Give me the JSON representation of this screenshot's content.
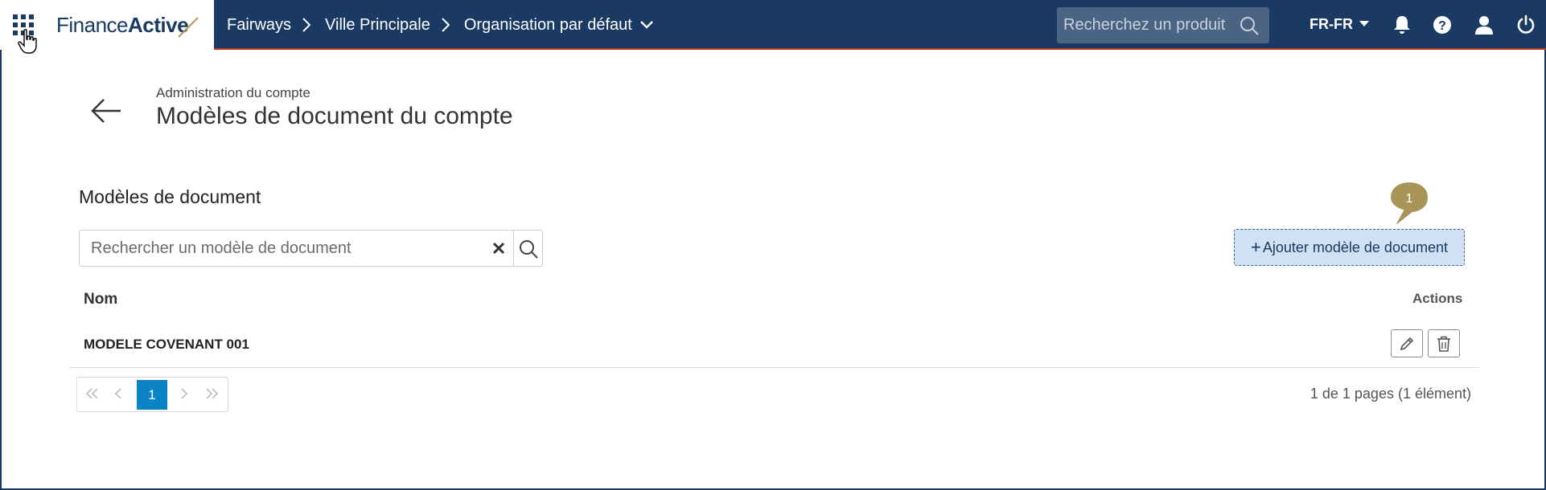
{
  "header": {
    "brand": {
      "part1": "Finance",
      "part2": "Active"
    },
    "breadcrumbs": [
      {
        "label": "Fairways"
      },
      {
        "label": "Ville Principale"
      },
      {
        "label": "Organisation par défaut"
      }
    ],
    "search_placeholder": "Recherchez un produit",
    "language": "FR-FR",
    "icons": [
      "apps-grid-icon",
      "bell-icon",
      "help-icon",
      "user-icon",
      "power-icon"
    ],
    "colors": {
      "bar": "#1b3a63",
      "accent_line": "#c0392b"
    }
  },
  "page": {
    "subtitle": "Administration du compte",
    "title": "Modèles de document du compte"
  },
  "section": {
    "title": "Modèles de document",
    "search_placeholder": "Rechercher un modèle de document",
    "add_button_label": "Ajouter modèle de document",
    "callout_number": "1"
  },
  "table": {
    "columns": {
      "name": "Nom",
      "actions": "Actions"
    },
    "rows": [
      {
        "name": "MODELE COVENANT 001"
      }
    ]
  },
  "pagination": {
    "current_page": "1",
    "info": "1 de 1 pages (1 élément)"
  }
}
